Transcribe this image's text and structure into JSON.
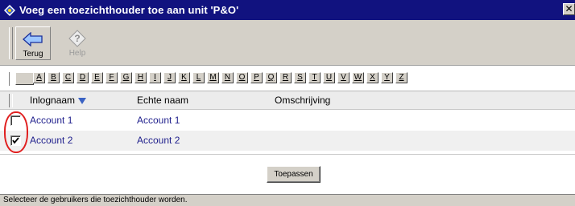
{
  "window": {
    "title": "Voeg een toezichthouder toe aan unit 'P&O'",
    "close_label": "✕"
  },
  "toolbar": {
    "back_label": "Terug",
    "back_icon": "arrow-left-icon",
    "help_label": "Help",
    "help_icon": "help-question-icon"
  },
  "alphabet": {
    "letters": [
      "A",
      "B",
      "C",
      "D",
      "E",
      "F",
      "G",
      "H",
      "I",
      "J",
      "K",
      "L",
      "M",
      "N",
      "O",
      "P",
      "Q",
      "R",
      "S",
      "T",
      "U",
      "V",
      "W",
      "X",
      "Y",
      "Z"
    ]
  },
  "table": {
    "columns": [
      "Inlognaam",
      "Echte naam",
      "Omschrijving"
    ],
    "sort_icon": "sort-down-icon",
    "rows": [
      {
        "login": "Account 1",
        "name": "Account 1",
        "description": "",
        "checked": false
      },
      {
        "login": "Account 2",
        "name": "Account 2",
        "description": "",
        "checked": true
      }
    ]
  },
  "actions": {
    "apply_label": "Toepassen"
  },
  "status": {
    "text": "Selecteer de gebruikers die toezichthouder worden."
  },
  "colors": {
    "titlebar": "#11127f",
    "link_text": "#1f1f8c",
    "highlight": "#e02020",
    "face": "#d4d0c8"
  }
}
